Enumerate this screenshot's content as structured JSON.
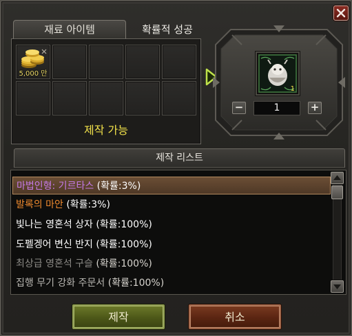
{
  "window": {
    "close_icon": "x-icon"
  },
  "tabs": [
    {
      "label": "재료 아이템",
      "active": true
    },
    {
      "label": "확률적 성공",
      "active": false
    }
  ],
  "materials": {
    "slots": [
      {
        "icon": "gold-coins-icon",
        "quantity": "5,000 만"
      },
      {},
      {},
      {},
      {},
      {},
      {},
      {},
      {},
      {}
    ],
    "status": "제작 가능"
  },
  "result": {
    "item_icon": "transformation-figure-icon",
    "item_count": "1",
    "quantity": "1",
    "minus_label": "−",
    "plus_label": "+"
  },
  "craft_list": {
    "title": "제작 리스트",
    "items": [
      {
        "name": "마법인형: 기르타스",
        "rate": "(확률:3%)",
        "color": "#c57ae8",
        "selected": true
      },
      {
        "name": "발록의 마안",
        "rate": "(확률:3%)",
        "color": "#f08a2e",
        "selected": false
      },
      {
        "name": "빛나는 영혼석 상자",
        "rate": "(확률:100%)",
        "color": "#ffffff",
        "selected": false
      },
      {
        "name": "도펠겡어 변신 반지",
        "rate": "(확률:100%)",
        "color": "#ffffff",
        "selected": false
      },
      {
        "name": "최상급 영혼석 구슬",
        "rate": "(확률:100%)",
        "color": "#8c8a86",
        "selected": false
      },
      {
        "name": "집행 무기 강화 주문서",
        "rate": "(확률:100%)",
        "color": "#b9b7b2",
        "selected": false
      }
    ]
  },
  "buttons": {
    "craft": "제작",
    "cancel": "취소"
  }
}
